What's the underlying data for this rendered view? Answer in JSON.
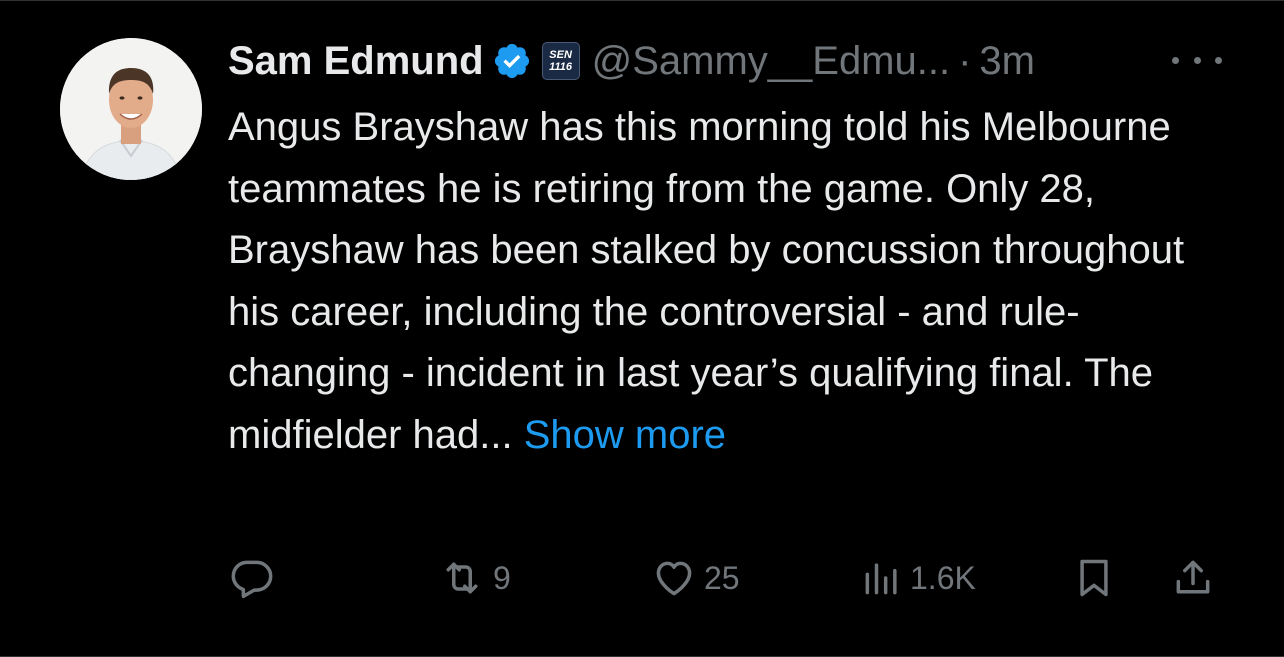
{
  "author": {
    "name": "Sam Edmund",
    "handle": "@Sammy__Edmu...",
    "separator": "·",
    "time": "3m",
    "verified": true,
    "affiliation_badge": {
      "line1": "SEN",
      "line2": "1116"
    }
  },
  "tweet": {
    "text": "Angus Brayshaw has this morning told his Melbourne teammates he is retiring from the game. Only 28, Brayshaw has been stalked by concussion throughout his career, including the controversial - and rule-changing - incident in last year’s qualifying final. The midfielder had... ",
    "show_more_label": "Show more"
  },
  "actions": {
    "reply_icon": "reply-icon",
    "retweet_count": "9",
    "like_count": "25",
    "views_count": "1.6K",
    "bookmark_icon": "bookmark-icon",
    "share_icon": "share-icon"
  },
  "colors": {
    "background": "#000000",
    "text": "#e7e9ea",
    "muted": "#71767b",
    "accent": "#1d9bf0"
  }
}
